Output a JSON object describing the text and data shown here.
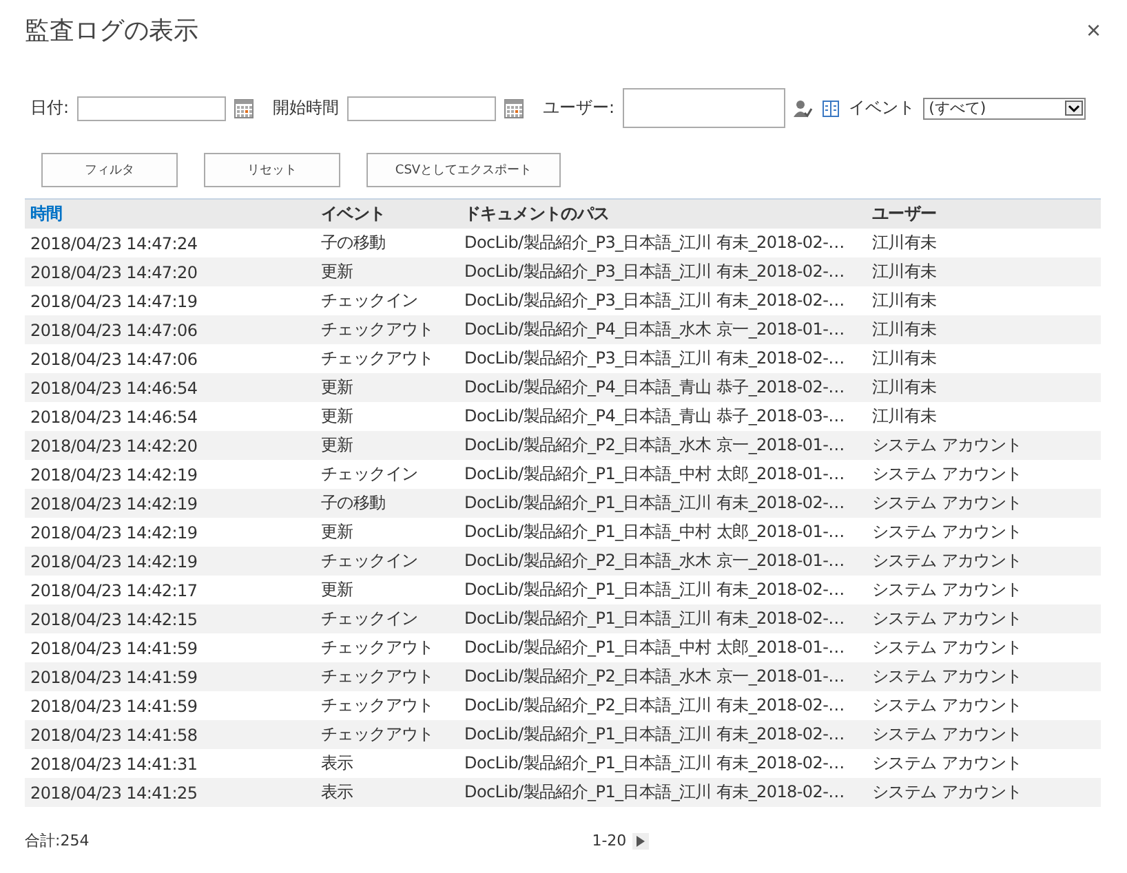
{
  "dialog": {
    "title": "監査ログの表示",
    "close": "×"
  },
  "filters": {
    "date_label": "日付:",
    "start_time_label": "開始時間",
    "user_label": "ユーザー:",
    "event_label": "イベント",
    "event_value": "(すべて)"
  },
  "buttons": [
    "フィルタ",
    "リセット",
    "CSVとしてエクスポート"
  ],
  "table": {
    "columns": [
      {
        "label": "時間",
        "sorted": true
      },
      {
        "label": "イベント",
        "sorted": false
      },
      {
        "label": "ドキュメントのパス",
        "sorted": false
      },
      {
        "label": "ユーザー",
        "sorted": false
      }
    ],
    "rows": [
      [
        "2018/04/23 14:47:24",
        "子の移動",
        "DocLib/製品紹介_P3_日本語_江川 有未_2018-02-…",
        "江川有未"
      ],
      [
        "2018/04/23 14:47:20",
        "更新",
        "DocLib/製品紹介_P3_日本語_江川 有未_2018-02-…",
        "江川有未"
      ],
      [
        "2018/04/23 14:47:19",
        "チェックイン",
        "DocLib/製品紹介_P3_日本語_江川 有未_2018-02-…",
        "江川有未"
      ],
      [
        "2018/04/23 14:47:06",
        "チェックアウト",
        "DocLib/製品紹介_P4_日本語_水木 京一_2018-01-…",
        "江川有未"
      ],
      [
        "2018/04/23 14:47:06",
        "チェックアウト",
        "DocLib/製品紹介_P3_日本語_江川 有未_2018-02-…",
        "江川有未"
      ],
      [
        "2018/04/23 14:46:54",
        "更新",
        "DocLib/製品紹介_P4_日本語_青山 恭子_2018-02-…",
        "江川有未"
      ],
      [
        "2018/04/23 14:46:54",
        "更新",
        "DocLib/製品紹介_P4_日本語_青山 恭子_2018-03-…",
        "江川有未"
      ],
      [
        "2018/04/23 14:42:20",
        "更新",
        "DocLib/製品紹介_P2_日本語_水木 京一_2018-01-…",
        "システム アカウント"
      ],
      [
        "2018/04/23 14:42:19",
        "チェックイン",
        "DocLib/製品紹介_P1_日本語_中村 太郎_2018-01-…",
        "システム アカウント"
      ],
      [
        "2018/04/23 14:42:19",
        "子の移動",
        "DocLib/製品紹介_P1_日本語_江川 有未_2018-02-…",
        "システム アカウント"
      ],
      [
        "2018/04/23 14:42:19",
        "更新",
        "DocLib/製品紹介_P1_日本語_中村 太郎_2018-01-…",
        "システム アカウント"
      ],
      [
        "2018/04/23 14:42:19",
        "チェックイン",
        "DocLib/製品紹介_P2_日本語_水木 京一_2018-01-…",
        "システム アカウント"
      ],
      [
        "2018/04/23 14:42:17",
        "更新",
        "DocLib/製品紹介_P1_日本語_江川 有未_2018-02-…",
        "システム アカウント"
      ],
      [
        "2018/04/23 14:42:15",
        "チェックイン",
        "DocLib/製品紹介_P1_日本語_江川 有未_2018-02-…",
        "システム アカウント"
      ],
      [
        "2018/04/23 14:41:59",
        "チェックアウト",
        "DocLib/製品紹介_P1_日本語_中村 太郎_2018-01-…",
        "システム アカウント"
      ],
      [
        "2018/04/23 14:41:59",
        "チェックアウト",
        "DocLib/製品紹介_P2_日本語_水木 京一_2018-01-…",
        "システム アカウント"
      ],
      [
        "2018/04/23 14:41:59",
        "チェックアウト",
        "DocLib/製品紹介_P2_日本語_江川 有未_2018-02-…",
        "システム アカウント"
      ],
      [
        "2018/04/23 14:41:58",
        "チェックアウト",
        "DocLib/製品紹介_P1_日本語_江川 有未_2018-02-…",
        "システム アカウント"
      ],
      [
        "2018/04/23 14:41:31",
        "表示",
        "DocLib/製品紹介_P1_日本語_江川 有未_2018-02-…",
        "システム アカウント"
      ],
      [
        "2018/04/23 14:41:25",
        "表示",
        "DocLib/製品紹介_P1_日本語_江川 有未_2018-02-…",
        "システム アカウント"
      ]
    ]
  },
  "footer": {
    "total": "合計:254",
    "range": "1-20"
  }
}
